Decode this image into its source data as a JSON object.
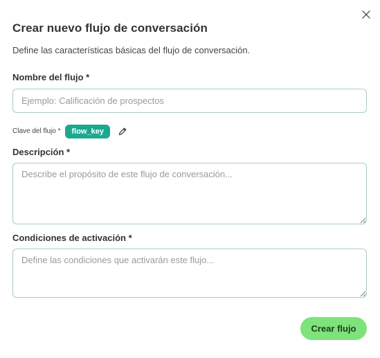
{
  "dialog": {
    "title": "Crear nuevo flujo de conversación",
    "subtitle": "Define las características básicas del flujo de conversación.",
    "close_icon": "close-icon"
  },
  "form": {
    "name": {
      "label": "Nombre del flujo *",
      "placeholder": "Ejemplo: Calificación de prospectos",
      "value": ""
    },
    "key": {
      "label": "Clave del flujo *",
      "value": "flow_key",
      "edit_icon": "pencil-icon"
    },
    "description": {
      "label": "Descripción *",
      "placeholder": "Describe el propósito de este flujo de conversación...",
      "value": ""
    },
    "conditions": {
      "label": "Condiciones de activación *",
      "placeholder": "Define las condiciones que activarán este flujo...",
      "value": ""
    },
    "submit_label": "Crear flujo"
  },
  "colors": {
    "chip": "#1aa98f",
    "submit": "#7de37a",
    "border": "#a9cbc6"
  }
}
